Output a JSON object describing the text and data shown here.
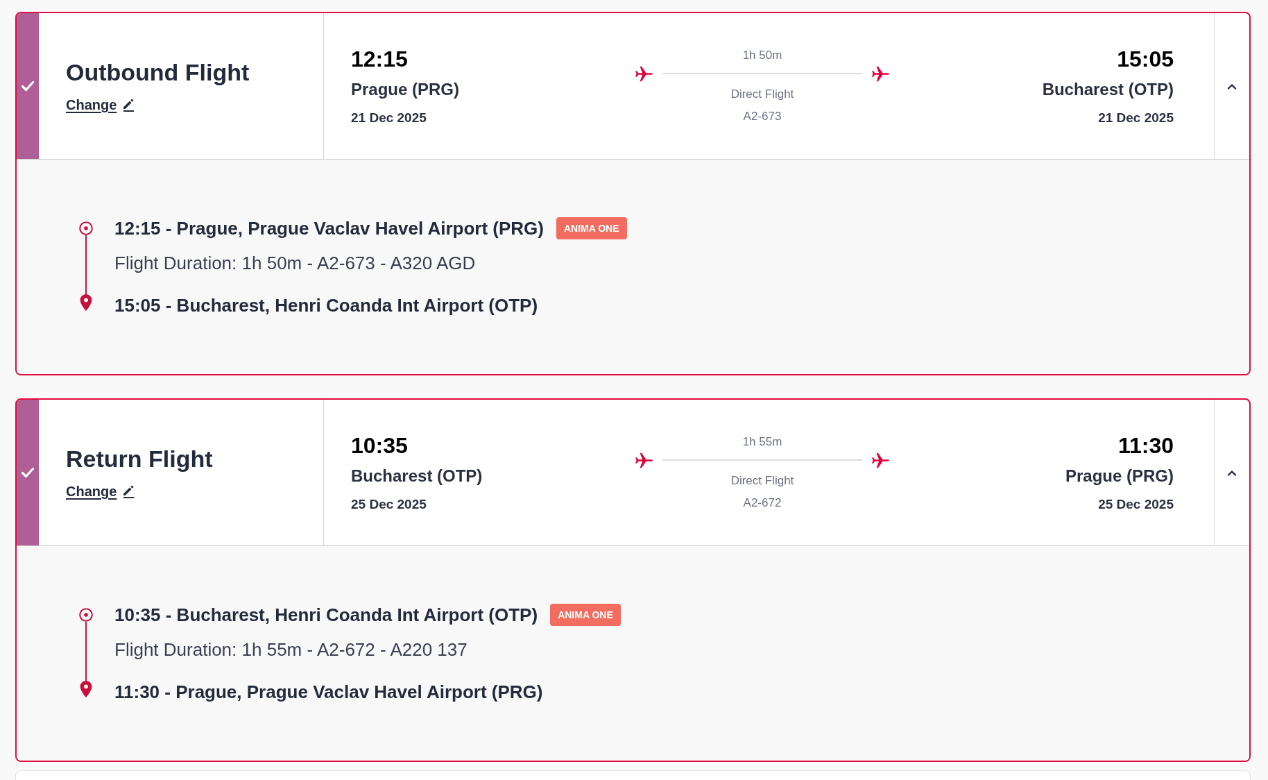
{
  "flights": [
    {
      "title": "Outbound Flight",
      "completed": true,
      "change_link": "Change",
      "expanded": true,
      "departure": {
        "time": "12:15",
        "city": "Prague (PRG)",
        "date": "21 Dec 2025"
      },
      "duration": "1h 50m",
      "stops": "Direct Flight",
      "flight_number": "A2-673",
      "arrival": {
        "time": "15:05",
        "city": "Bucharest (OTP)",
        "date": "21 Dec 2025"
      },
      "details": {
        "origin": "12:15 - Prague, Prague Vaclav Havel Airport (PRG)",
        "badge": "ANIMA ONE",
        "info": "Flight Duration: 1h 50m - A2-673 - A320 AGD",
        "destination": "15:05 - Bucharest, Henri Coanda Int Airport (OTP)"
      }
    },
    {
      "title": "Return Flight",
      "completed": true,
      "change_link": "Change",
      "expanded": true,
      "departure": {
        "time": "10:35",
        "city": "Bucharest (OTP)",
        "date": "25 Dec 2025"
      },
      "duration": "1h 55m",
      "stops": "Direct Flight",
      "flight_number": "A2-672",
      "arrival": {
        "time": "11:30",
        "city": "Prague (PRG)",
        "date": "25 Dec 2025"
      },
      "details": {
        "origin": "10:35 - Bucharest, Henri Coanda Int Airport (OTP)",
        "badge": "ANIMA ONE",
        "info": "Flight Duration: 1h 55m - A2-672 - A220 137",
        "destination": "11:30 - Prague, Prague Vaclav Havel Airport (PRG)"
      }
    }
  ]
}
